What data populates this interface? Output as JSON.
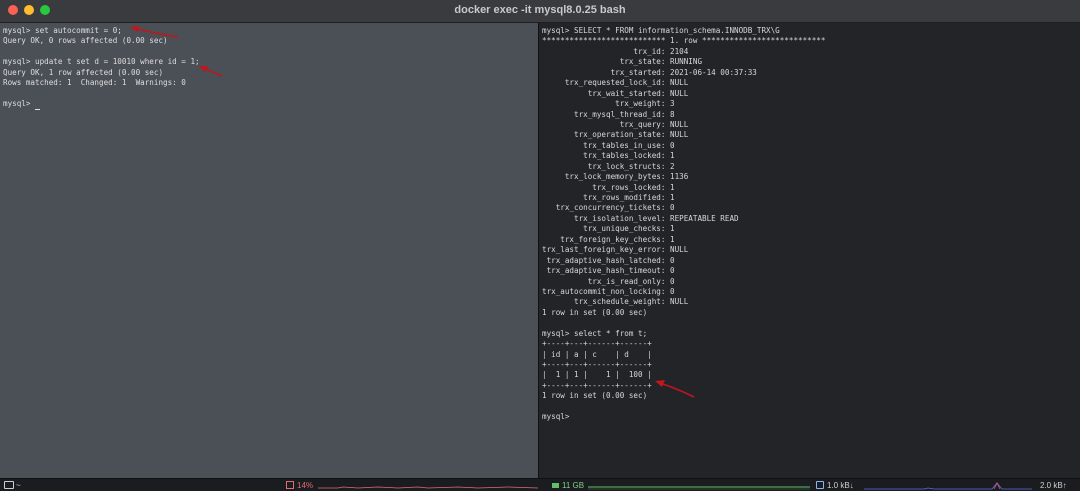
{
  "window": {
    "title": "docker exec -it mysql8.0.25 bash"
  },
  "left_pane": {
    "lines": [
      "mysql> set autocommit = 0;",
      "Query OK, 0 rows affected (0.00 sec)",
      "",
      "mysql> update t set d = 10010 where id = 1;",
      "Query OK, 1 row affected (0.00 sec)",
      "Rows matched: 1  Changed: 1  Warnings: 0",
      "",
      "mysql> "
    ]
  },
  "right_pane": {
    "lines": [
      "mysql> SELECT * FROM information_schema.INNODB_TRX\\G",
      "*************************** 1. row ***************************",
      "                    trx_id: 2104",
      "                 trx_state: RUNNING",
      "               trx_started: 2021-06-14 00:37:33",
      "     trx_requested_lock_id: NULL",
      "          trx_wait_started: NULL",
      "                trx_weight: 3",
      "       trx_mysql_thread_id: 8",
      "                 trx_query: NULL",
      "       trx_operation_state: NULL",
      "         trx_tables_in_use: 0",
      "         trx_tables_locked: 1",
      "          trx_lock_structs: 2",
      "     trx_lock_memory_bytes: 1136",
      "           trx_rows_locked: 1",
      "         trx_rows_modified: 1",
      "   trx_concurrency_tickets: 0",
      "       trx_isolation_level: REPEATABLE READ",
      "         trx_unique_checks: 1",
      "    trx_foreign_key_checks: 1",
      "trx_last_foreign_key_error: NULL",
      " trx_adaptive_hash_latched: 0",
      " trx_adaptive_hash_timeout: 0",
      "          trx_is_read_only: 0",
      "trx_autocommit_non_locking: 0",
      "       trx_schedule_weight: NULL",
      "1 row in set (0.00 sec)",
      "",
      "mysql> select * from t;",
      "+----+---+------+------+",
      "| id | a | c    | d    |",
      "+----+---+------+------+",
      "|  1 | 1 |    1 |  100 |",
      "+----+---+------+------+",
      "1 row in set (0.00 sec)",
      "",
      "mysql> "
    ]
  },
  "statusbar": {
    "path": "~",
    "cpu": "14%",
    "memory": "11 GB",
    "net_down": "1.0 kB↓",
    "net_up": "2.0 kB↑"
  },
  "colors": {
    "annotation_arrow": "#c0161c",
    "cpu": "#e06c75",
    "memory": "#5fbf6a",
    "network": "#5b6cf0"
  },
  "icons": {
    "close": "close-icon",
    "minimize": "minimize-icon",
    "zoom": "zoom-icon",
    "folder": "folder-icon",
    "cpu": "cpu-icon",
    "memory": "memory-icon",
    "network": "network-icon",
    "arrow": "annotation-arrow-icon"
  }
}
